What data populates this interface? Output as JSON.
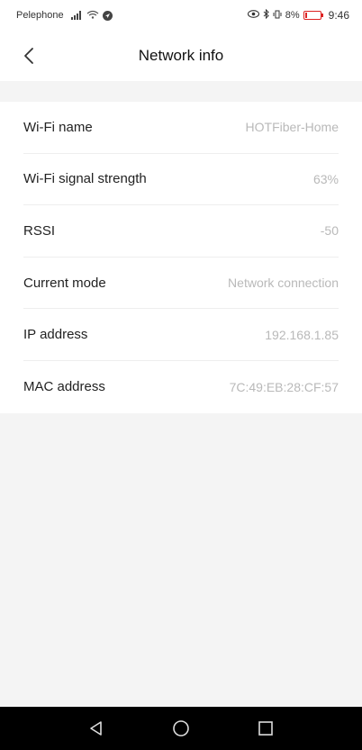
{
  "status_bar": {
    "carrier": "Pelephone",
    "battery": "8%",
    "time": "9:46"
  },
  "header": {
    "title": "Network info",
    "back_icon": "chevron-left-icon"
  },
  "network_info": {
    "rows": [
      {
        "label": "Wi-Fi name",
        "value": "HOTFiber-Home"
      },
      {
        "label": "Wi-Fi signal strength",
        "value": "63%"
      },
      {
        "label": "RSSI",
        "value": "-50"
      },
      {
        "label": "Current mode",
        "value": "Network connection"
      },
      {
        "label": "IP address",
        "value": "192.168.1.85"
      },
      {
        "label": "MAC address",
        "value": "7C:49:EB:28:CF:57"
      }
    ]
  },
  "nav_bar": {
    "back_icon": "triangle-back-icon",
    "home_icon": "circle-home-icon",
    "recents_icon": "square-recents-icon"
  },
  "colors": {
    "background": "#f4f4f4",
    "surface": "#ffffff",
    "value_text": "#b9b9b9",
    "battery_low": "#dd2222"
  }
}
